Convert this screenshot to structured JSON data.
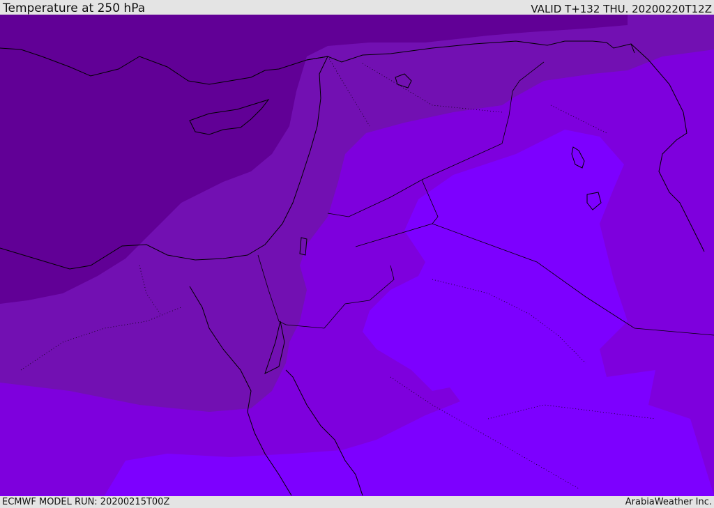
{
  "header": {
    "title": "Temperature at 250 hPa",
    "valid": "VALID T+132 THU. 20200220T12Z"
  },
  "footer": {
    "model_run": "ECMWF MODEL RUN: 20200215T00Z",
    "credit": "ArabiaWeather Inc."
  },
  "map": {
    "colors": {
      "darkest": "#610096",
      "dark": "#7210b2",
      "medium": "#7e00dd",
      "light": "#7d00ff",
      "coastline": "#000000"
    }
  }
}
